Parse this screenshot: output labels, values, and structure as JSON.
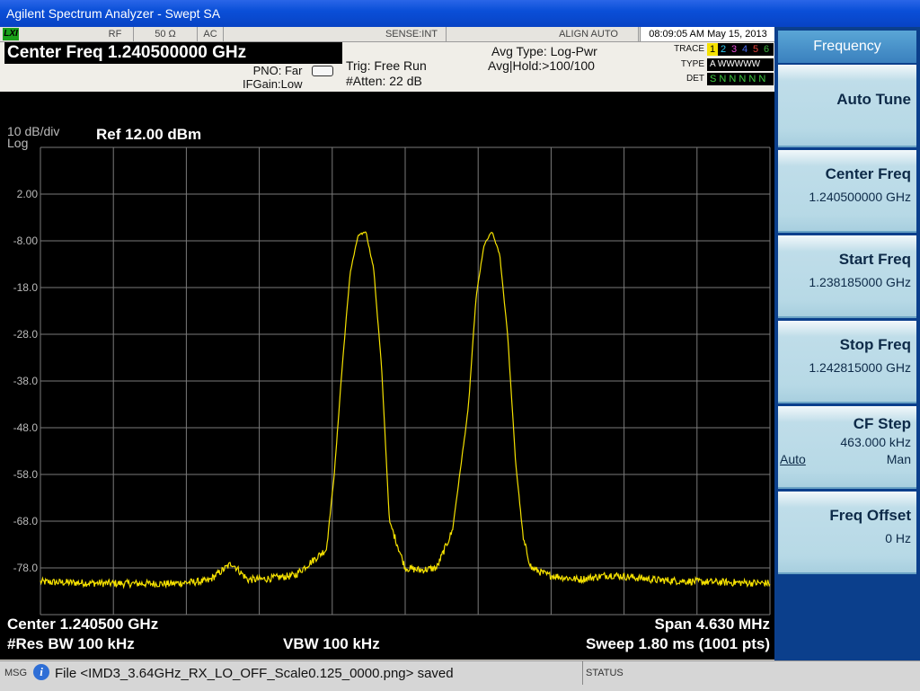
{
  "window": {
    "title": "Agilent Spectrum Analyzer - Swept SA"
  },
  "status_bar": {
    "lxi": "LXI",
    "rf": "RF",
    "impedance": "50 Ω",
    "coupling": "AC",
    "sense": "SENSE:INT",
    "align": "ALIGN AUTO",
    "datetime": "08:09:05 AM May 15, 2013"
  },
  "header": {
    "center_freq": "Center Freq  1.240500000 GHz",
    "pno": "PNO: Far",
    "ifgain": "IFGain:Low",
    "trig": "Trig: Free Run",
    "atten": "#Atten: 22 dB",
    "avg_type": "Avg Type: Log-Pwr",
    "avg_hold": "Avg|Hold:>100/100",
    "trace_label": "TRACE",
    "type_label": "TYPE",
    "det_label": "DET",
    "trace_numbers": [
      "1",
      "2",
      "3",
      "4",
      "5",
      "6"
    ],
    "trace_colors": [
      "#f5e100",
      "#2ec6ee",
      "#e64bd6",
      "#4b6cf0",
      "#e8433a",
      "#3fb23f"
    ],
    "type_value": "A WWWWW",
    "det_value": "S N N N N N"
  },
  "plot": {
    "scale": "10 dB/div",
    "scale_mode": "Log",
    "ref_level": "Ref 12.00 dBm",
    "y_ticks": [
      "2.00",
      "-8.00",
      "-18.0",
      "-28.0",
      "-38.0",
      "-48.0",
      "-58.0",
      "-68.0",
      "-78.0"
    ],
    "center": "Center 1.240500 GHz",
    "span": "Span 4.630 MHz",
    "res_bw": "#Res BW 100 kHz",
    "vbw": "VBW 100 kHz",
    "sweep": "Sweep  1.80 ms (1001 pts)"
  },
  "chart_data": {
    "type": "line",
    "x_unit": "GHz",
    "y_unit": "dBm",
    "xlim": [
      1.238185,
      1.242815
    ],
    "ylim": [
      -88,
      12
    ],
    "grid": true,
    "trace_color": "#f5e100",
    "series": [
      {
        "x": [
          1.238185,
          1.2386,
          1.239,
          1.23925,
          1.2394,
          1.2395,
          1.2396,
          1.2398,
          1.24,
          1.24005,
          1.2401,
          1.24015,
          1.2402,
          1.24025,
          1.2403,
          1.24035,
          1.2404,
          1.2405,
          1.2406,
          1.2407,
          1.2408,
          1.2409,
          1.24095,
          1.241,
          1.24105,
          1.2411,
          1.24115,
          1.2412,
          1.24125,
          1.2413,
          1.2414,
          1.2416,
          1.2418,
          1.2421,
          1.2424,
          1.2427,
          1.242815
        ],
        "y": [
          -81.0,
          -81.3,
          -81.4,
          -80.8,
          -77.0,
          -80.5,
          -80.4,
          -79.6,
          -74.0,
          -58.0,
          -35.0,
          -15.0,
          -7.0,
          -6.0,
          -14.0,
          -35.0,
          -68.0,
          -78.0,
          -78.5,
          -78.0,
          -70.0,
          -44.0,
          -20.0,
          -9.0,
          -6.0,
          -11.0,
          -28.0,
          -55.0,
          -72.0,
          -78.0,
          -79.5,
          -80.5,
          -79.5,
          -80.6,
          -81.0,
          -81.2,
          -81.3
        ]
      }
    ]
  },
  "message_bar": {
    "label": "MSG",
    "message": "File <IMD3_3.64GHz_RX_LO_OFF_Scale0.125_0000.png> saved",
    "status_label": "STATUS"
  },
  "softkeys": {
    "menu_title": "Frequency",
    "auto_tune": "Auto Tune",
    "center_freq_label": "Center Freq",
    "center_freq_value": "1.240500000 GHz",
    "start_freq_label": "Start Freq",
    "start_freq_value": "1.238185000 GHz",
    "stop_freq_label": "Stop Freq",
    "stop_freq_value": "1.242815000 GHz",
    "cf_step_label": "CF Step",
    "cf_step_value": "463.000 kHz",
    "cf_step_auto": "Auto",
    "cf_step_man": "Man",
    "freq_offset_label": "Freq Offset",
    "freq_offset_value": "0 Hz"
  }
}
